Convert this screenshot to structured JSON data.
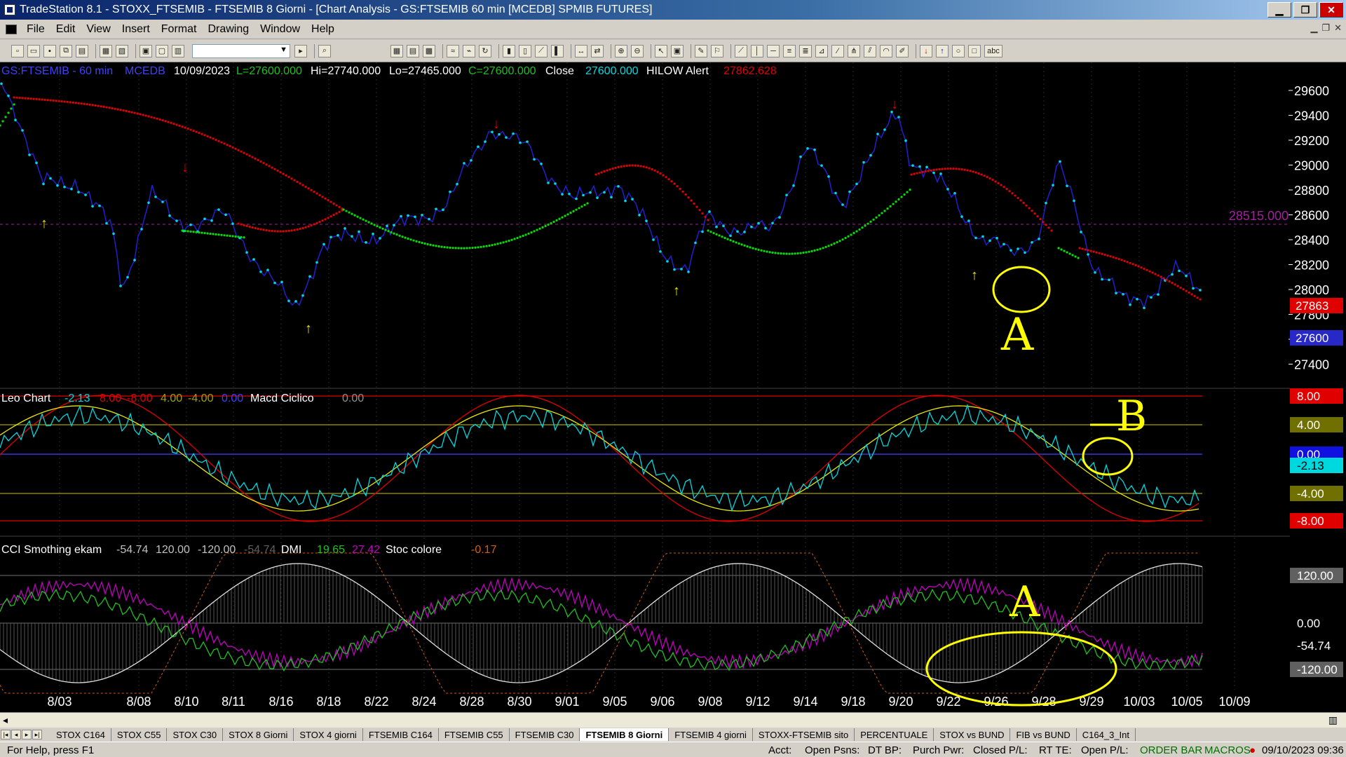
{
  "window": {
    "title": "TradeStation 8.1 - STOXX_FTSEMIB - FTSEMIB  8 Giorni - [Chart Analysis - GS:FTSEMIB  60 min  [MCEDB] SPMIB FUTURES]",
    "min": "▁",
    "max": "❐",
    "close": "✕"
  },
  "menu": [
    "File",
    "Edit",
    "View",
    "Insert",
    "Format",
    "Drawing",
    "Window",
    "Help"
  ],
  "toolbar_icons": [
    "new-icon",
    "open-icon",
    "save-icon",
    "copy-icon",
    "paste-icon",
    "print-icon",
    "print-preview-icon",
    "zoom-icon",
    "zoom-out-icon",
    "cursor-icon",
    "drawing-icon",
    "arrow-up-icon",
    "arrow-down-icon",
    "circle-icon",
    "text-icon"
  ],
  "toolbar_text": {
    "text_tool": "abc"
  },
  "header_line": {
    "symbol": "GS:FTSEMIB - 60 min",
    "feed": "MCEDB",
    "date": "10/09/2023",
    "L": "L=27600.000",
    "H": "Hi=27740.000",
    "Lo": "Lo=27465.000",
    "C": "C=27600.000",
    "close_lbl": "Close",
    "close_val": "27600.000",
    "hilow": "HILOW Alert",
    "hilow_val": "27862.628"
  },
  "colors": {
    "price": "#2020d0",
    "cyan": "#00d8e0",
    "red": "#e00000",
    "green": "#00e000",
    "yellow": "#e8e800",
    "magenta": "#c000c0",
    "purple": "#a020a0",
    "olive": "#a0a000",
    "annot": "#ffff00"
  },
  "price_panel": {
    "y_ticks": [
      "29600",
      "29400",
      "29200",
      "29000",
      "28800",
      "28600",
      "28400",
      "28200",
      "28000",
      "27800",
      "27600",
      "27400"
    ],
    "line_label": "28515.000",
    "tag_red": "27863",
    "tag_blue": "27600"
  },
  "leo_panel": {
    "name": "Leo Chart",
    "v1": "-2.13",
    "v2": "8.00",
    "v3": "-8.00",
    "v4": "4.00",
    "v5": "-4.00",
    "v6": "0.00",
    "name2": "Macd Ciclico",
    "v7": "0.00",
    "tags": [
      "8.00",
      "4.00",
      "0.00",
      "-2.13",
      "-4.00",
      "-8.00"
    ]
  },
  "cci_panel": {
    "name": "CCI Smothing ekam",
    "v1": "-54.74",
    "v2": "120.00",
    "v3": "-120.00",
    "v4": "-54.74",
    "name2": "DMI",
    "v5": "19.65",
    "v6": "27.42",
    "name3": "Stoc colore",
    "v7": "-0.17",
    "tags": [
      "120.00",
      "0.00",
      "-54.74",
      "-120.00"
    ]
  },
  "x_dates": [
    "8/03",
    "8/08",
    "8/10",
    "8/11",
    "8/16",
    "8/18",
    "8/22",
    "8/24",
    "8/28",
    "8/30",
    "9/01",
    "9/05",
    "9/06",
    "9/08",
    "9/12",
    "9/14",
    "9/18",
    "9/20",
    "9/22",
    "9/26",
    "9/28",
    "9/29",
    "10/03",
    "10/05",
    "10/09"
  ],
  "annotations": [
    "A",
    "B",
    "A"
  ],
  "tabs": [
    "STOX C164",
    "STOX C55",
    "STOX  C30",
    "STOX  8 Giorni",
    "STOX 4 giorni",
    "FTSEMIB C164",
    "FTSEMIB C55",
    "FTSEMIB C30",
    "FTSEMIB  8 Giorni",
    "FTSEMIB  4 giorni",
    "STOXX-FTSEMIB sito",
    "PERCENTUALE",
    "STOX vs BUND",
    "FIB vs BUND",
    "C164_3_Int"
  ],
  "active_tab": "FTSEMIB  8 Giorni",
  "status": {
    "help": "For Help, press F1",
    "acct": "Acct:",
    "open_psns": "Open Psns:",
    "dt_bp": "DT BP:",
    "purch": "Purch Pwr:",
    "closed": "Closed P/L:",
    "rt": "RT TE:",
    "open_pl": "Open P/L:",
    "orderbar": "ORDER BAR",
    "macros": "MACROS",
    "datetime": "09/10/2023 09:36"
  }
}
